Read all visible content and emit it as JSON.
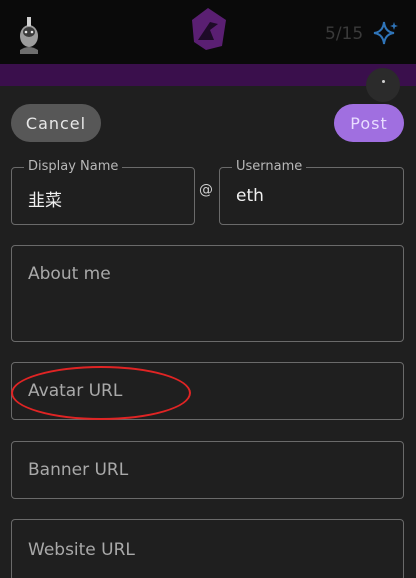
{
  "header": {
    "counter": "5/15",
    "icons": {
      "avatar": "user-avatar",
      "logo": "app-logo",
      "sparkle": "sparkle-icon"
    }
  },
  "actions": {
    "cancel_label": "Cancel",
    "post_label": "Post"
  },
  "form": {
    "display_name": {
      "label": "Display Name",
      "value": "韭菜"
    },
    "at_symbol": "@",
    "username": {
      "label": "Username",
      "value": "eth"
    },
    "about": {
      "placeholder": "About me"
    },
    "avatar_url": {
      "placeholder": "Avatar URL"
    },
    "banner_url": {
      "placeholder": "Banner URL"
    },
    "website_url": {
      "placeholder": "Website URL"
    }
  },
  "colors": {
    "accent_strip": "#3a0f4c",
    "post_button": "#a06fe0",
    "highlight": "#e02424"
  }
}
